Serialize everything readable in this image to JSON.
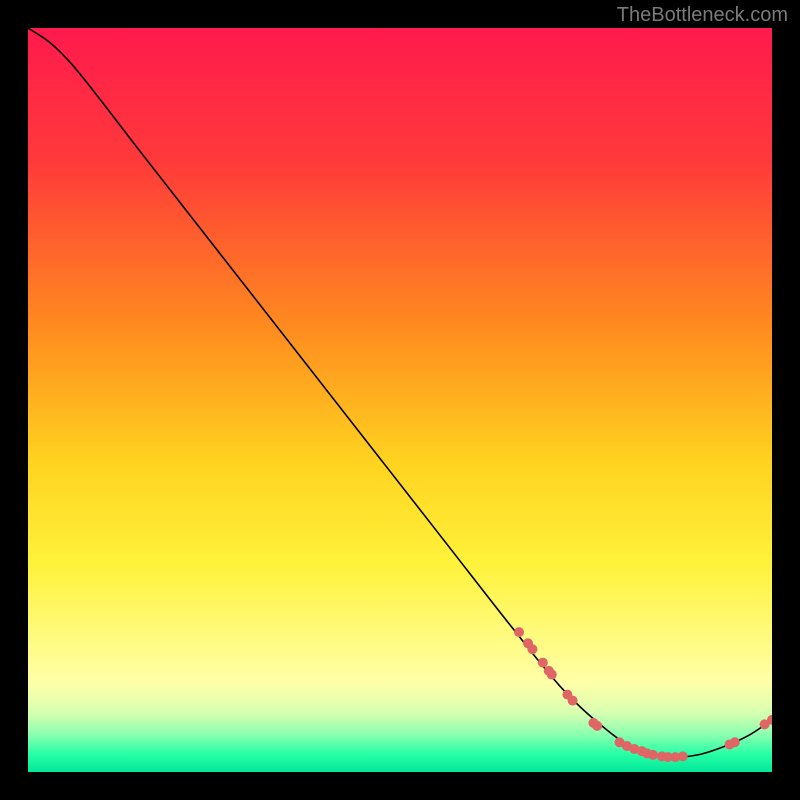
{
  "attribution": "TheBottleneck.com",
  "chart_data": {
    "type": "line",
    "title": "",
    "xlabel": "",
    "ylabel": "",
    "xlim": [
      0,
      100
    ],
    "ylim": [
      0,
      100
    ],
    "gradient_stops": [
      {
        "offset": 0.0,
        "color": "#ff1a4d"
      },
      {
        "offset": 0.18,
        "color": "#ff3a3a"
      },
      {
        "offset": 0.4,
        "color": "#ff8a1f"
      },
      {
        "offset": 0.58,
        "color": "#ffd21f"
      },
      {
        "offset": 0.72,
        "color": "#fff23a"
      },
      {
        "offset": 0.82,
        "color": "#fffb80"
      },
      {
        "offset": 0.88,
        "color": "#ffffa8"
      },
      {
        "offset": 0.92,
        "color": "#d8ffb0"
      },
      {
        "offset": 0.95,
        "color": "#8affb0"
      },
      {
        "offset": 0.975,
        "color": "#2affa5"
      },
      {
        "offset": 1.0,
        "color": "#00e89a"
      }
    ],
    "curve_points": [
      {
        "x": 0.0,
        "y": 100.0
      },
      {
        "x": 3.0,
        "y": 98.0
      },
      {
        "x": 6.0,
        "y": 95.0
      },
      {
        "x": 10.0,
        "y": 90.0
      },
      {
        "x": 15.0,
        "y": 83.5
      },
      {
        "x": 25.0,
        "y": 70.7
      },
      {
        "x": 40.0,
        "y": 51.5
      },
      {
        "x": 55.0,
        "y": 32.3
      },
      {
        "x": 65.0,
        "y": 19.5
      },
      {
        "x": 72.0,
        "y": 11.0
      },
      {
        "x": 78.0,
        "y": 5.5
      },
      {
        "x": 82.0,
        "y": 3.0
      },
      {
        "x": 86.0,
        "y": 2.0
      },
      {
        "x": 90.0,
        "y": 2.3
      },
      {
        "x": 94.0,
        "y": 3.6
      },
      {
        "x": 97.0,
        "y": 5.0
      },
      {
        "x": 100.0,
        "y": 7.0
      }
    ],
    "marker_points": [
      {
        "x": 66.0,
        "y": 18.8
      },
      {
        "x": 67.2,
        "y": 17.3
      },
      {
        "x": 67.8,
        "y": 16.5
      },
      {
        "x": 69.2,
        "y": 14.7
      },
      {
        "x": 70.0,
        "y": 13.6
      },
      {
        "x": 70.4,
        "y": 13.1
      },
      {
        "x": 72.5,
        "y": 10.4
      },
      {
        "x": 73.2,
        "y": 9.6
      },
      {
        "x": 76.0,
        "y": 6.6
      },
      {
        "x": 76.5,
        "y": 6.2
      },
      {
        "x": 79.5,
        "y": 4.0
      },
      {
        "x": 80.5,
        "y": 3.5
      },
      {
        "x": 81.5,
        "y": 3.1
      },
      {
        "x": 82.5,
        "y": 2.8
      },
      {
        "x": 83.2,
        "y": 2.5
      },
      {
        "x": 84.0,
        "y": 2.3
      },
      {
        "x": 85.2,
        "y": 2.1
      },
      {
        "x": 86.0,
        "y": 2.0
      },
      {
        "x": 87.0,
        "y": 2.0
      },
      {
        "x": 88.0,
        "y": 2.1
      },
      {
        "x": 94.3,
        "y": 3.7
      },
      {
        "x": 95.0,
        "y": 4.0
      },
      {
        "x": 99.0,
        "y": 6.4
      },
      {
        "x": 100.0,
        "y": 7.0
      }
    ],
    "marker_color": "#e06666",
    "marker_radius": 5,
    "curve_stroke": "#000000",
    "curve_width": 1.6
  }
}
